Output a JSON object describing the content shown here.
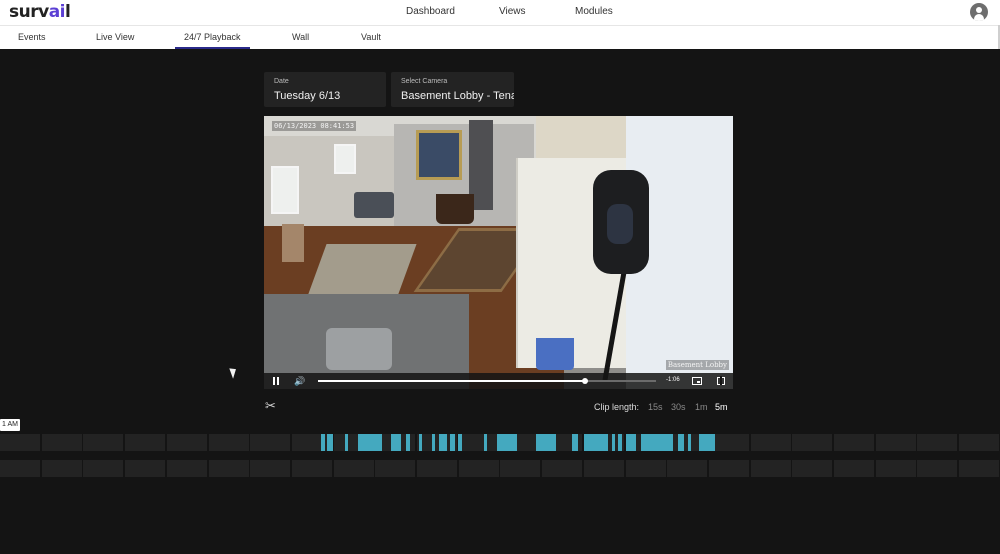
{
  "app": {
    "logo_prefix": "surv",
    "logo_accent": "ai",
    "logo_suffix": "l",
    "accent_color": "#5b3fd4"
  },
  "top_nav": [
    "Dashboard",
    "Views",
    "Modules"
  ],
  "sub_nav": {
    "tabs": [
      "Events",
      "Live View",
      "24/7 Playback",
      "Wall",
      "Vault"
    ],
    "active": "24/7 Playback"
  },
  "date_selector": {
    "label": "Date",
    "value": "Tuesday 6/13"
  },
  "camera_selector": {
    "label": "Select Camera",
    "value": "Basement Lobby - Tenant"
  },
  "video": {
    "timestamp": "06/13/2023 08:41:53",
    "camera_label": "Basement Lobby",
    "remaining_time": "-1:06",
    "progress_fraction": 0.79
  },
  "clip": {
    "label": "Clip length:",
    "options": [
      "15s",
      "30s",
      "1m",
      "5m"
    ],
    "selected": "5m"
  },
  "timeline": {
    "hour_marker": "1 AM",
    "event_color": "#44a9bf"
  }
}
